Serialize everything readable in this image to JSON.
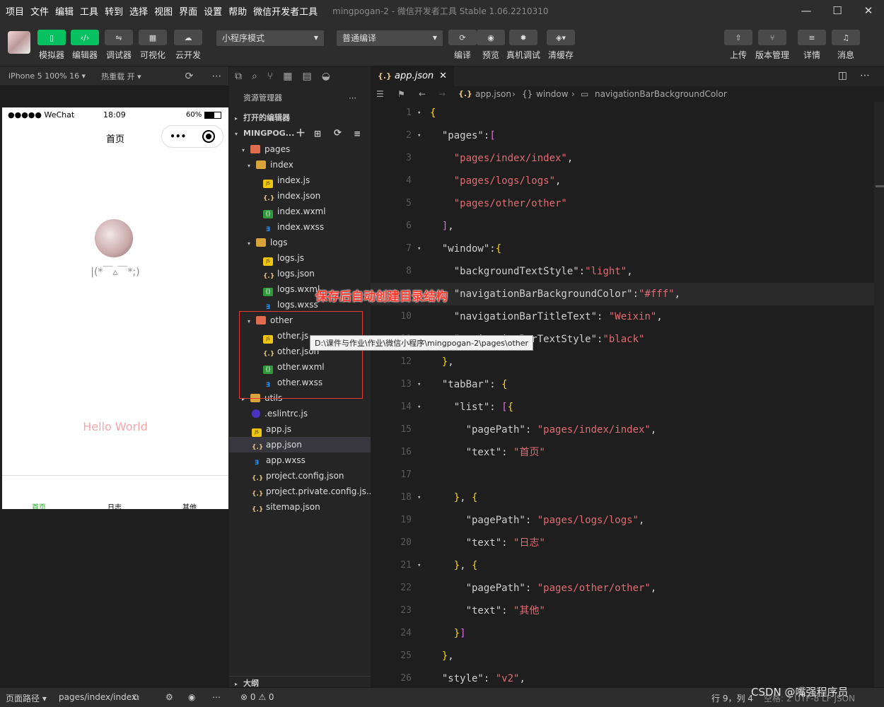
{
  "menu": [
    "项目",
    "文件",
    "编辑",
    "工具",
    "转到",
    "选择",
    "视图",
    "界面",
    "设置",
    "帮助",
    "微信开发者工具"
  ],
  "window_title": "mingpogan-2 - 微信开发者工具 Stable 1.06.2210310",
  "window_controls": {
    "minimize": "—",
    "maximize": "☐",
    "close": "✕"
  },
  "toolbar": {
    "left_buttons": [
      {
        "label": "模拟器",
        "icon": "phone-icon",
        "active": true
      },
      {
        "label": "编辑器",
        "icon": "code-icon",
        "active": true
      },
      {
        "label": "调试器",
        "icon": "debug-icon",
        "active": false
      },
      {
        "label": "可视化",
        "icon": "layout-icon",
        "active": false
      },
      {
        "label": "云开发",
        "icon": "cloud-icon",
        "active": false
      }
    ],
    "mode_select": "小程序模式",
    "compile_select": "普通编译",
    "mid_buttons": [
      {
        "label": "编译",
        "icon": "refresh-icon"
      },
      {
        "label": "预览",
        "icon": "eye-icon"
      },
      {
        "label": "真机调试",
        "icon": "bug-icon"
      },
      {
        "label": "清缓存",
        "icon": "layers-icon"
      }
    ],
    "right_buttons": [
      {
        "label": "上传",
        "icon": "upload-icon"
      },
      {
        "label": "版本管理",
        "icon": "branch-icon"
      },
      {
        "label": "详情",
        "icon": "menu-icon"
      },
      {
        "label": "消息",
        "icon": "bell-icon"
      }
    ]
  },
  "simulator": {
    "device": "iPhone 5 100% 16 ▾",
    "hot_reload": "热重载 开 ▾",
    "status_signal": "●●●●● WeChat",
    "status_time": "18:09",
    "status_battery": "60%",
    "nav_title": "首页",
    "nickname": "|(*￣▵￣*;)",
    "hello": "Hello World",
    "tabs": [
      "首页",
      "日志",
      "其他"
    ]
  },
  "explorer": {
    "title": "资源管理器",
    "open_editors": "打开的编辑器",
    "project": "MINGPOG...",
    "outline": "大纲",
    "tree": [
      {
        "depth": 1,
        "type": "folderr",
        "caret": "▾",
        "name": "pages"
      },
      {
        "depth": 2,
        "type": "folder",
        "caret": "▾",
        "name": "index"
      },
      {
        "depth": 3,
        "type": "js",
        "name": "index.js"
      },
      {
        "depth": 3,
        "type": "json",
        "name": "index.json"
      },
      {
        "depth": 3,
        "type": "wxml",
        "name": "index.wxml"
      },
      {
        "depth": 3,
        "type": "wxss",
        "name": "index.wxss"
      },
      {
        "depth": 2,
        "type": "folder",
        "caret": "▾",
        "name": "logs"
      },
      {
        "depth": 3,
        "type": "js",
        "name": "logs.js"
      },
      {
        "depth": 3,
        "type": "json",
        "name": "logs.json"
      },
      {
        "depth": 3,
        "type": "wxml",
        "name": "logs.wxml"
      },
      {
        "depth": 3,
        "type": "wxss",
        "name": "logs.wxss"
      },
      {
        "depth": 2,
        "type": "folderr",
        "caret": "▾",
        "name": "other"
      },
      {
        "depth": 3,
        "type": "js",
        "name": "other.js"
      },
      {
        "depth": 3,
        "type": "json",
        "name": "other.json"
      },
      {
        "depth": 3,
        "type": "wxml",
        "name": "other.wxml"
      },
      {
        "depth": 3,
        "type": "wxss",
        "name": "other.wxss"
      },
      {
        "depth": 1,
        "type": "folder",
        "caret": "▸",
        "name": "utils"
      },
      {
        "depth": 1,
        "type": "eslint",
        "name": ".eslintrc.js"
      },
      {
        "depth": 1,
        "type": "js",
        "name": "app.js"
      },
      {
        "depth": 1,
        "type": "json",
        "name": "app.json",
        "selected": true
      },
      {
        "depth": 1,
        "type": "wxss",
        "name": "app.wxss"
      },
      {
        "depth": 1,
        "type": "json",
        "name": "project.config.json"
      },
      {
        "depth": 1,
        "type": "json",
        "name": "project.private.config.js..."
      },
      {
        "depth": 1,
        "type": "json",
        "name": "sitemap.json"
      }
    ]
  },
  "editor": {
    "tab": "app.json",
    "breadcrumb": [
      "app.json",
      "window",
      "navigationBarBackgroundColor"
    ],
    "lines": [
      {
        "n": "1",
        "fold": "▾",
        "t": "{"
      },
      {
        "n": "2",
        "fold": "▾",
        "t": "  \"pages\":["
      },
      {
        "n": "3",
        "t": "    \"pages/index/index\","
      },
      {
        "n": "4",
        "t": "    \"pages/logs/logs\","
      },
      {
        "n": "5",
        "t": "    \"pages/other/other\""
      },
      {
        "n": "6",
        "t": "  ],"
      },
      {
        "n": "7",
        "fold": "▾",
        "t": "  \"window\":{"
      },
      {
        "n": "8",
        "t": "    \"backgroundTextStyle\":\"light\","
      },
      {
        "n": "9",
        "t": "    \"navigationBarBackgroundColor\":\"#fff\",",
        "current": true
      },
      {
        "n": "10",
        "t": "    \"navigationBarTitleText\": \"Weixin\","
      },
      {
        "n": "11",
        "t": "    \"navigationBarTextStyle\":\"black\""
      },
      {
        "n": "12",
        "t": "  },"
      },
      {
        "n": "13",
        "fold": "▾",
        "t": "  \"tabBar\": {"
      },
      {
        "n": "14",
        "fold": "▾",
        "t": "    \"list\": [{"
      },
      {
        "n": "15",
        "t": "      \"pagePath\": \"pages/index/index\","
      },
      {
        "n": "16",
        "t": "      \"text\": \"首页\""
      },
      {
        "n": "17",
        "t": ""
      },
      {
        "n": "18",
        "fold": "▾",
        "t": "    }, {"
      },
      {
        "n": "19",
        "t": "      \"pagePath\": \"pages/logs/logs\","
      },
      {
        "n": "20",
        "t": "      \"text\": \"日志\""
      },
      {
        "n": "21",
        "fold": "▾",
        "t": "    }, {"
      },
      {
        "n": "22",
        "t": "      \"pagePath\": \"pages/other/other\","
      },
      {
        "n": "23",
        "t": "      \"text\": \"其他\""
      },
      {
        "n": "24",
        "t": "    }]"
      },
      {
        "n": "25",
        "t": "  },"
      },
      {
        "n": "26",
        "t": "  \"style\": \"v2\","
      }
    ]
  },
  "statusbar": {
    "page_path_label": "页面路径 ▾",
    "page_path": "pages/index/index",
    "errors": "⊗ 0 ⚠ 0",
    "cursor": "行 9，列 4",
    "right": "空格: 2   UTF-8   LF   JSON"
  },
  "overlay": {
    "annotation": "保存后自动创建目录结构",
    "tooltip": "D:\\课件与作业\\作业\\微信小程序\\mingpogan-2\\pages\\other",
    "watermark": "CSDN @嘴强程序员"
  }
}
